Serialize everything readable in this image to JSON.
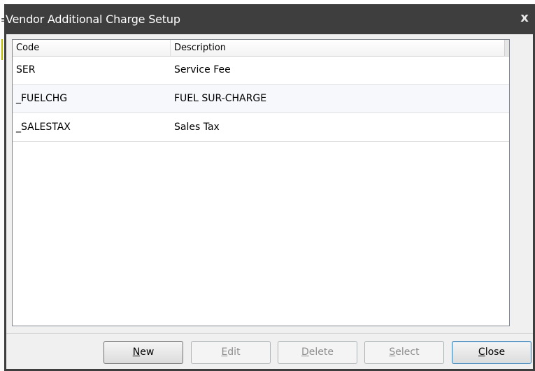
{
  "window": {
    "title": "Vendor Additional Charge Setup",
    "close_glyph": "x"
  },
  "table": {
    "columns": [
      "Code",
      "Description"
    ],
    "rows": [
      {
        "code": "SER",
        "description": "Service Fee"
      },
      {
        "code": "_FUELCHG",
        "description": "FUEL SUR-CHARGE"
      },
      {
        "code": "_SALESTAX",
        "description": "Sales Tax"
      }
    ]
  },
  "buttons": {
    "new": {
      "access": "N",
      "rest": "ew",
      "enabled": true
    },
    "edit": {
      "access": "E",
      "rest": "dit",
      "enabled": false
    },
    "delete": {
      "access": "D",
      "rest": "elete",
      "enabled": false
    },
    "select": {
      "access": "S",
      "rest": "elect",
      "enabled": false
    },
    "close": {
      "access": "C",
      "rest": "lose",
      "enabled": true
    }
  },
  "colors": {
    "titlebar": "#3e3e3e",
    "client": "#f0f0f0",
    "disabled_text": "#8d8d8d"
  }
}
